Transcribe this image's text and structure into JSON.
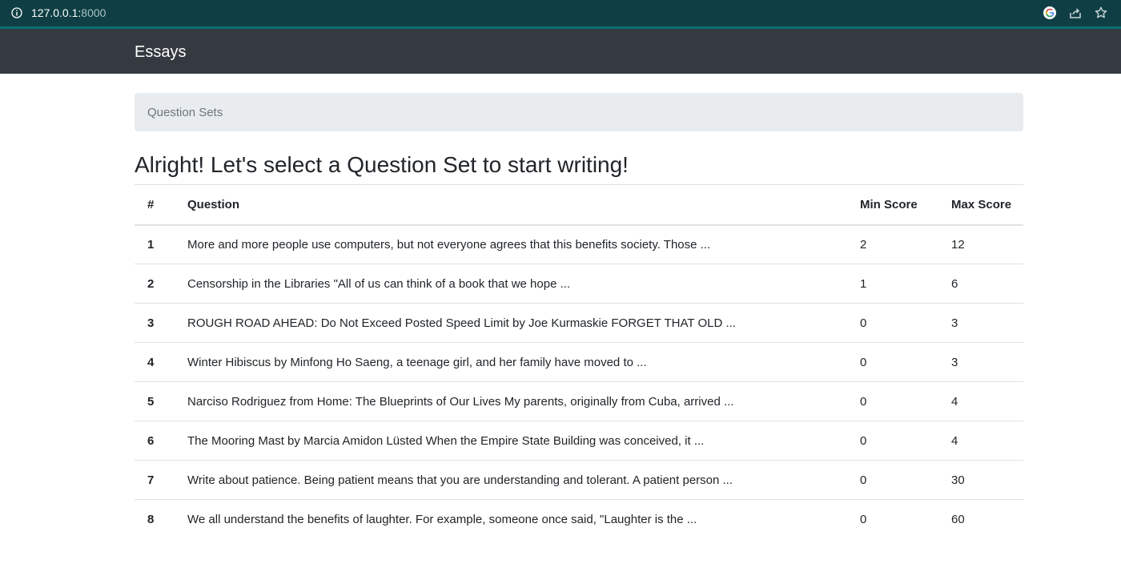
{
  "browser": {
    "url_host": "127.0.0.1:",
    "url_port": "8000"
  },
  "navbar": {
    "brand": "Essays"
  },
  "breadcrumb": {
    "label": "Question Sets"
  },
  "page": {
    "title": "Alright! Let's select a Question Set to start writing!"
  },
  "table": {
    "headers": {
      "num": "#",
      "question": "Question",
      "min_score": "Min Score",
      "max_score": "Max Score"
    },
    "rows": [
      {
        "num": "1",
        "question": "More and more people use computers, but not everyone agrees that this benefits society. Those ...",
        "min": "2",
        "max": "12"
      },
      {
        "num": "2",
        "question": "Censorship in the Libraries \"All of us can think of a book that we hope ...",
        "min": "1",
        "max": "6"
      },
      {
        "num": "3",
        "question": "ROUGH ROAD AHEAD: Do Not Exceed Posted Speed Limit by Joe Kurmaskie FORGET THAT OLD ...",
        "min": "0",
        "max": "3"
      },
      {
        "num": "4",
        "question": "Winter Hibiscus by Minfong Ho Saeng, a teenage girl, and her family have moved to ...",
        "min": "0",
        "max": "3"
      },
      {
        "num": "5",
        "question": "Narciso Rodriguez from Home: The Blueprints of Our Lives My parents, originally from Cuba, arrived ...",
        "min": "0",
        "max": "4"
      },
      {
        "num": "6",
        "question": "The Mooring Mast by Marcia Amidon Lüsted When the Empire State Building was conceived, it ...",
        "min": "0",
        "max": "4"
      },
      {
        "num": "7",
        "question": "Write about patience. Being patient means that you are understanding and tolerant. A patient person ...",
        "min": "0",
        "max": "30"
      },
      {
        "num": "8",
        "question": "We all understand the benefits of laughter. For example, someone once said, \"Laughter is the ...",
        "min": "0",
        "max": "60"
      }
    ]
  },
  "icons": [
    "info-icon",
    "google-icon",
    "share-icon",
    "bookmark-star-icon"
  ]
}
